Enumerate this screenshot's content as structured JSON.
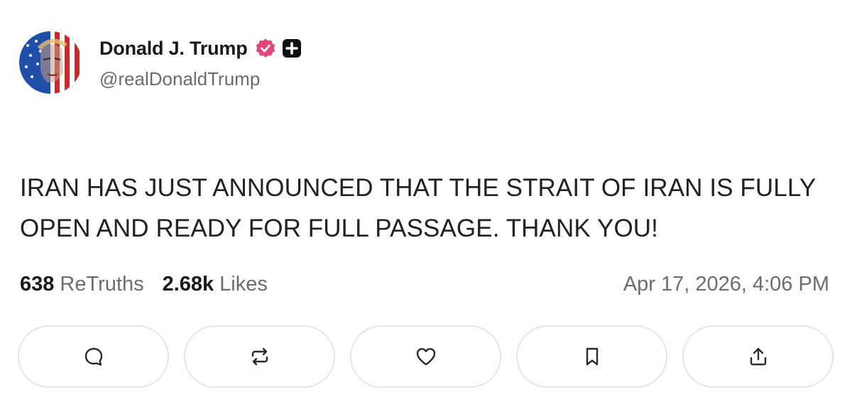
{
  "author": {
    "display_name": "Donald J. Trump",
    "handle": "@realDonaldTrump",
    "verified_icon": "verified-badge-icon",
    "plus_icon": "plus-badge-icon"
  },
  "post": {
    "text": "IRAN HAS JUST ANNOUNCED THAT THE STRAIT OF IRAN IS FULLY OPEN AND READY FOR FULL PASSAGE. THANK YOU!"
  },
  "stats": {
    "retruths_count": "638",
    "retruths_label": "ReTruths",
    "likes_count": "2.68k",
    "likes_label": "Likes",
    "timestamp": "Apr 17, 2026, 4:06 PM"
  },
  "actions": [
    {
      "name": "reply",
      "icon": "comment-icon"
    },
    {
      "name": "retruth",
      "icon": "repost-icon"
    },
    {
      "name": "like",
      "icon": "heart-icon"
    },
    {
      "name": "bookmark",
      "icon": "bookmark-icon"
    },
    {
      "name": "share",
      "icon": "share-icon"
    }
  ],
  "colors": {
    "verified": "#e5457b",
    "text": "#1a1a1a",
    "muted": "#6b6b73",
    "border": "#e6e6ea"
  }
}
